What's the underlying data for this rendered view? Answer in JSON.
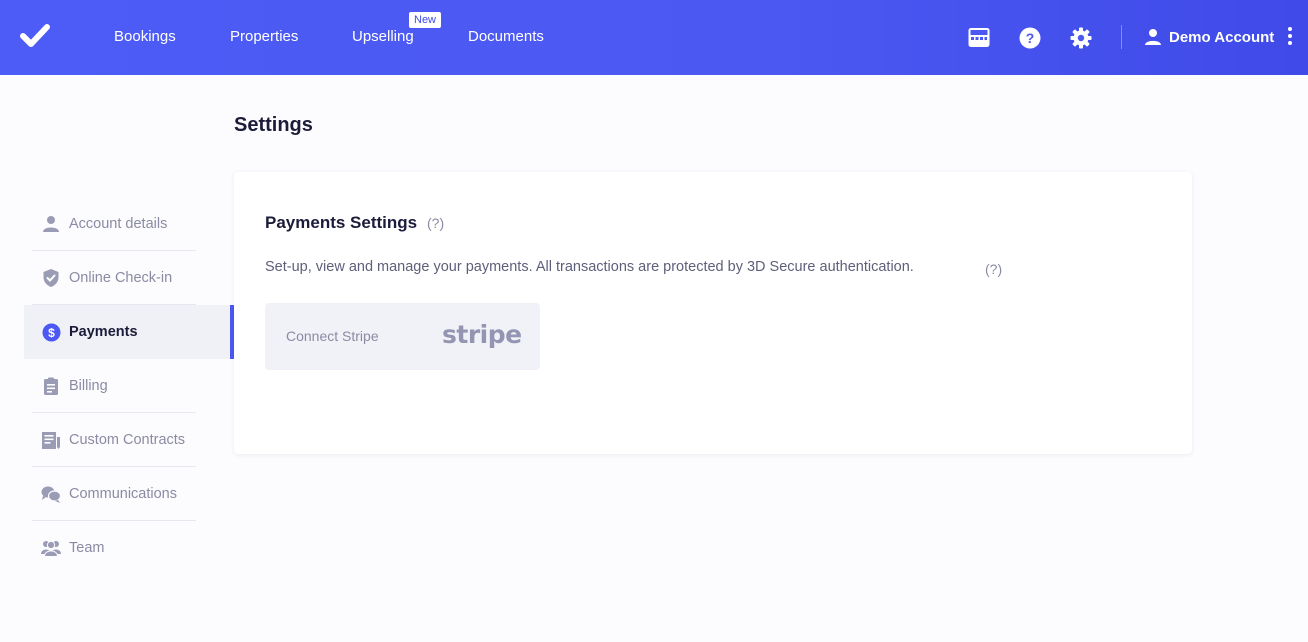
{
  "header": {
    "nav": [
      {
        "label": "Bookings"
      },
      {
        "label": "Properties"
      },
      {
        "label": "Upselling",
        "badge": "New"
      },
      {
        "label": "Documents"
      }
    ],
    "icons": [
      "calendar-grid-icon",
      "help-icon",
      "gear-icon"
    ],
    "account_name": "Demo Account",
    "colors": {
      "bar_start": "#4d5cf6",
      "bar_end": "#3f4ae8"
    }
  },
  "page": {
    "title": "Settings"
  },
  "sidebar": {
    "items": [
      {
        "label": "Account details",
        "icon": "user-icon",
        "active": false
      },
      {
        "label": "Online Check-in",
        "icon": "shield-check-icon",
        "active": false
      },
      {
        "label": "Payments",
        "icon": "dollar-circle-icon",
        "active": true
      },
      {
        "label": "Billing",
        "icon": "clipboard-icon",
        "active": false
      },
      {
        "label": "Custom Contracts",
        "icon": "contract-icon",
        "active": false
      },
      {
        "label": "Communications",
        "icon": "chat-bubbles-icon",
        "active": false
      },
      {
        "label": "Team",
        "icon": "team-icon",
        "active": false
      }
    ]
  },
  "payments": {
    "title": "Payments Settings",
    "title_help": "(?)",
    "description": "Set-up, view and manage your payments. All transactions are protected by 3D Secure authentication.",
    "description_help": "(?)",
    "connect_label": "Connect Stripe",
    "stripe_logo": "stripe"
  },
  "colors": {
    "accent": "#4b58f1",
    "muted_text": "#8a8ba3",
    "dark_text": "#1c1c3a"
  }
}
